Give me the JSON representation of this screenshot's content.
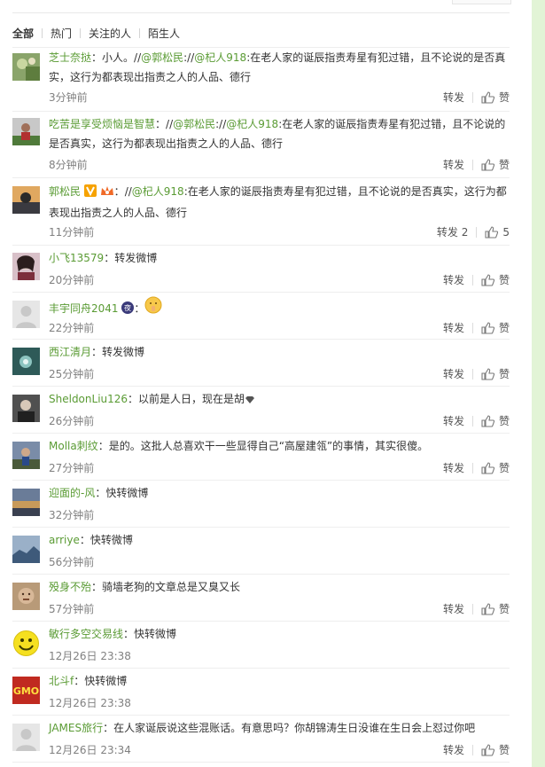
{
  "filters": {
    "all": "全部",
    "hot": "热门",
    "following": "关注的人",
    "strangers": "陌生人"
  },
  "actions": {
    "repost": "转发",
    "like": "赞"
  },
  "comments": [
    {
      "user": "芝士奈挞",
      "text_pre": "：小人。",
      "sep1": "//",
      "m1": "@郭松民",
      "sep2": "://",
      "m2": "@杞人918",
      "text_post": ":在老人家的诞辰指责寿星有犯过错，且不论说的是否真实，这行为都表现出指责之人的人品、德行",
      "time": "3分钟前"
    },
    {
      "user": "吃苦是享受烦恼是智慧",
      "text_pre": "：",
      "sep1": "//",
      "m1": "@郭松民",
      "sep2": "://",
      "m2": "@杞人918",
      "text_post": ":在老人家的诞辰指责寿星有犯过错，且不论说的是否真实，这行为都表现出指责之人的人品、德行",
      "time": "8分钟前"
    },
    {
      "user": "郭松民",
      "text_pre": "：",
      "sep1": "//",
      "m1": "@杞人918",
      "text_post": ":在老人家的诞辰指责寿星有犯过错，且不论说的是否真实，这行为都表现出指责之人的人品、德行",
      "time": "11分钟前",
      "repost_count": "2",
      "like_count": "5"
    },
    {
      "user": "小飞13579",
      "text": "：转发微博",
      "time": "20分钟前"
    },
    {
      "user": "丰宇同舟2041",
      "text": "：",
      "time": "22分钟前"
    },
    {
      "user": "西江清月",
      "text": "：转发微博",
      "time": "25分钟前"
    },
    {
      "user": "SheldonLiu126",
      "text": "：以前是人日，现在是胡",
      "time": "26分钟前"
    },
    {
      "user": "Molla刺纹",
      "text": "：是的。这批人总喜欢干一些显得自己“高屋建瓴”的事情，其实很傻。",
      "time": "27分钟前"
    },
    {
      "user": "迎面的-风",
      "text": "：快转微博",
      "time": "32分钟前"
    },
    {
      "user": "arriye",
      "text": "：快转微博",
      "time": "56分钟前"
    },
    {
      "user": "殁身不殆",
      "text": "：骑墙老狗的文章总是又臭又长",
      "time": "57分钟前"
    },
    {
      "user": "敏行多空交易线",
      "text": "：快转微博",
      "time": "12月26日 23:38"
    },
    {
      "user": "北斗f",
      "text": "：快转微博",
      "time": "12月26日 23:38"
    },
    {
      "user": "JAMES旅行",
      "text": "：在人家诞辰说这些混账话。有意思吗？你胡锦涛生日没谁在生日会上怼过你吧",
      "time": "12月26日 23:34"
    }
  ],
  "avatar_logo_text": "GMO",
  "colors": {
    "link": "#5a9b34",
    "strip": "#e2f4d6",
    "muted": "#808080"
  }
}
